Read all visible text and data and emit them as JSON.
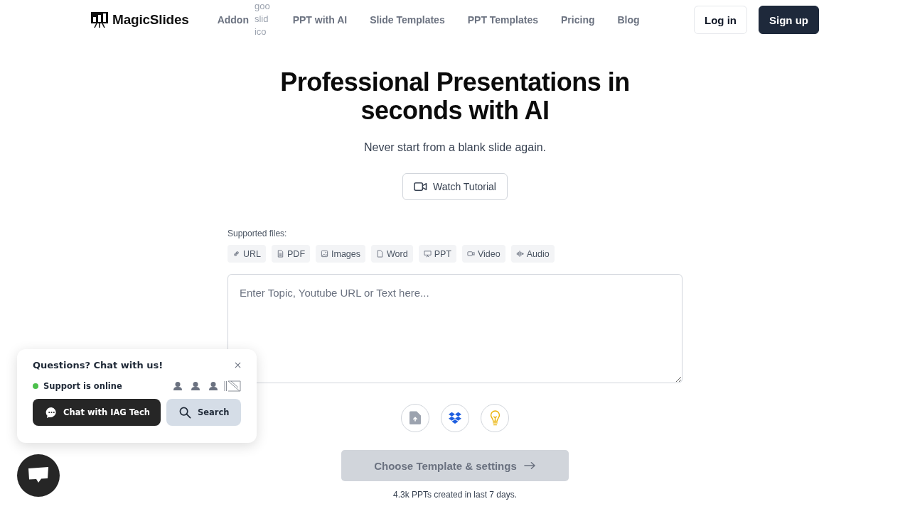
{
  "header": {
    "logo": "MagicSlides",
    "nav": [
      {
        "label": "Addon",
        "image_alt": "goo slid ico"
      },
      {
        "label": "PPT with AI"
      },
      {
        "label": "Slide Templates"
      },
      {
        "label": "PPT Templates"
      },
      {
        "label": "Pricing"
      },
      {
        "label": "Blog"
      }
    ],
    "login": "Log in",
    "signup": "Sign up"
  },
  "hero": {
    "title": "Professional Presentations in seconds with AI",
    "subtitle": "Never start from a blank slide again.",
    "tutorial_button": "Watch Tutorial"
  },
  "form": {
    "supported_label": "Supported files:",
    "file_types": [
      {
        "label": "URL",
        "kind": "link"
      },
      {
        "label": "PDF",
        "kind": "document"
      },
      {
        "label": "Images",
        "kind": "image"
      },
      {
        "label": "Word",
        "kind": "file"
      },
      {
        "label": "PPT",
        "kind": "presentation"
      },
      {
        "label": "Video",
        "kind": "video"
      },
      {
        "label": "Audio",
        "kind": "audio"
      }
    ],
    "placeholder": "Enter Topic, Youtube URL or Text here...",
    "submit": {
      "label": "Choose Template & settings",
      "disabled": true
    },
    "stats": "4.3k PPTs created in last 7 days."
  },
  "chat": {
    "title": "Questions? Chat with us!",
    "status": "Support is online",
    "online": true,
    "chat_button": "Chat with IAG Tech",
    "search_button": "Search"
  }
}
